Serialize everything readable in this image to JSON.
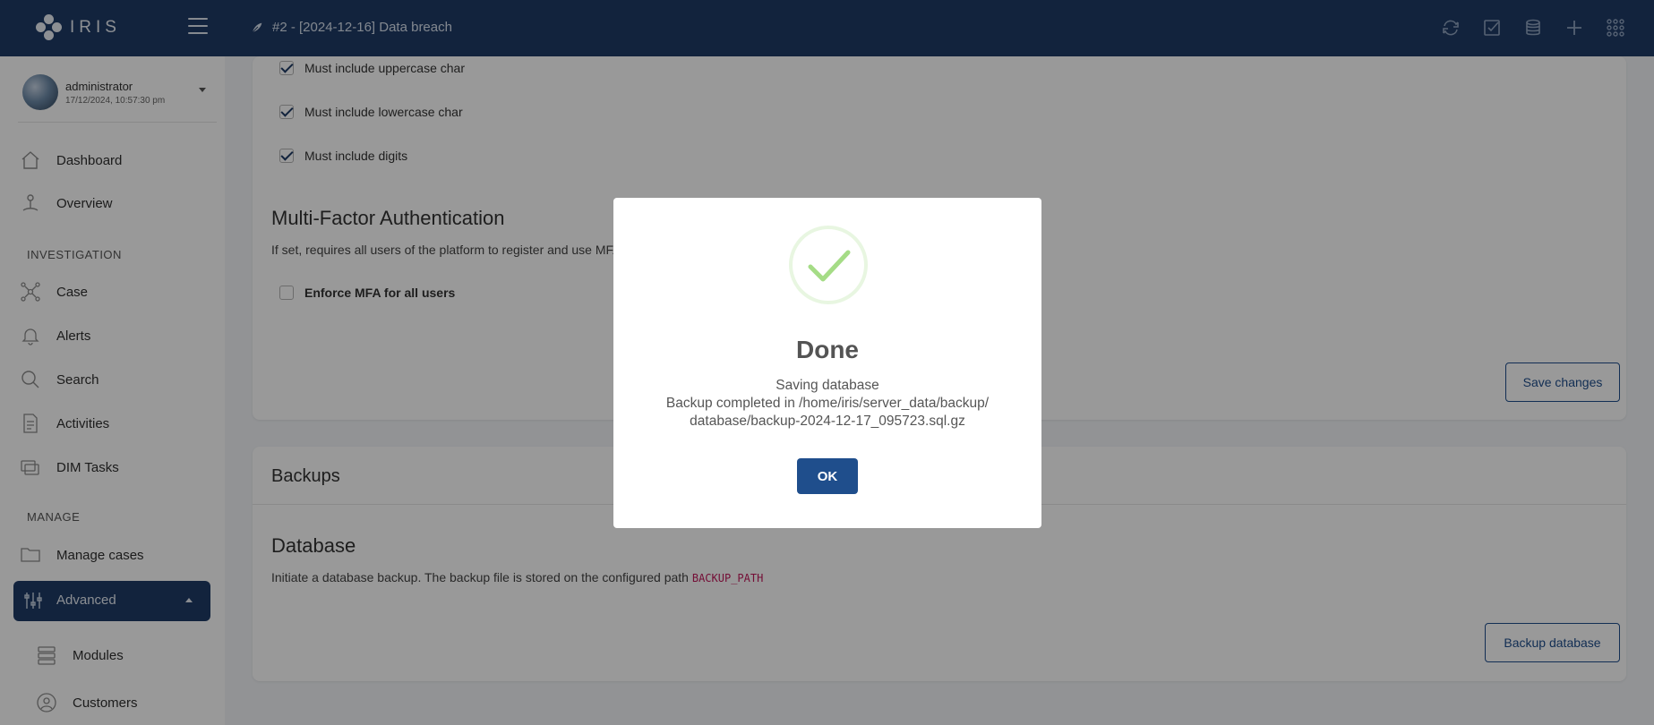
{
  "app": {
    "logo_text": "IRIS",
    "case_title": "#2 - [2024-12-16] Data breach"
  },
  "user": {
    "name": "administrator",
    "timestamp": "17/12/2024, 10:57:30 pm"
  },
  "sidebar": {
    "items": [
      {
        "label": "Dashboard",
        "icon": "home-icon"
      },
      {
        "label": "Overview",
        "icon": "person-pin-icon"
      },
      {
        "label": "Case",
        "icon": "network-icon"
      },
      {
        "label": "Alerts",
        "icon": "bell-icon"
      },
      {
        "label": "Search",
        "icon": "search-icon"
      },
      {
        "label": "Activities",
        "icon": "document-icon"
      },
      {
        "label": "DIM Tasks",
        "icon": "stack-icon"
      },
      {
        "label": "Manage cases",
        "icon": "folder-icon"
      },
      {
        "label": "Advanced",
        "icon": "sliders-icon"
      },
      {
        "label": "Modules",
        "icon": "server-icon"
      },
      {
        "label": "Customers",
        "icon": "user-circle-icon"
      }
    ],
    "sections": {
      "investigation": "INVESTIGATION",
      "manage": "MANAGE"
    }
  },
  "password_policy": {
    "checks": [
      {
        "label": "Must include uppercase char",
        "checked": true
      },
      {
        "label": "Must include lowercase char",
        "checked": true
      },
      {
        "label": "Must include digits",
        "checked": true
      }
    ]
  },
  "mfa": {
    "title": "Multi-Factor Authentication",
    "desc": "If set, requires all users of the platform to register and use MFA",
    "enforce_label": "Enforce MFA for all users",
    "save_label": "Save changes"
  },
  "backups": {
    "title": "Backups",
    "db_title": "Database",
    "db_desc": "Initiate a database backup. The backup file is stored on the configured path",
    "db_path": "BACKUP_PATH",
    "backup_button": "Backup database"
  },
  "modal": {
    "title": "Done",
    "line1": "Saving database",
    "line2": "Backup completed in /home/iris/server_data/backup/",
    "line3": "database/backup-2024-12-17_095723.sql.gz",
    "ok_label": "OK"
  },
  "colors": {
    "topbar": "#1f3b66",
    "accent": "#1f4e8c",
    "success": "#a5dc86"
  }
}
